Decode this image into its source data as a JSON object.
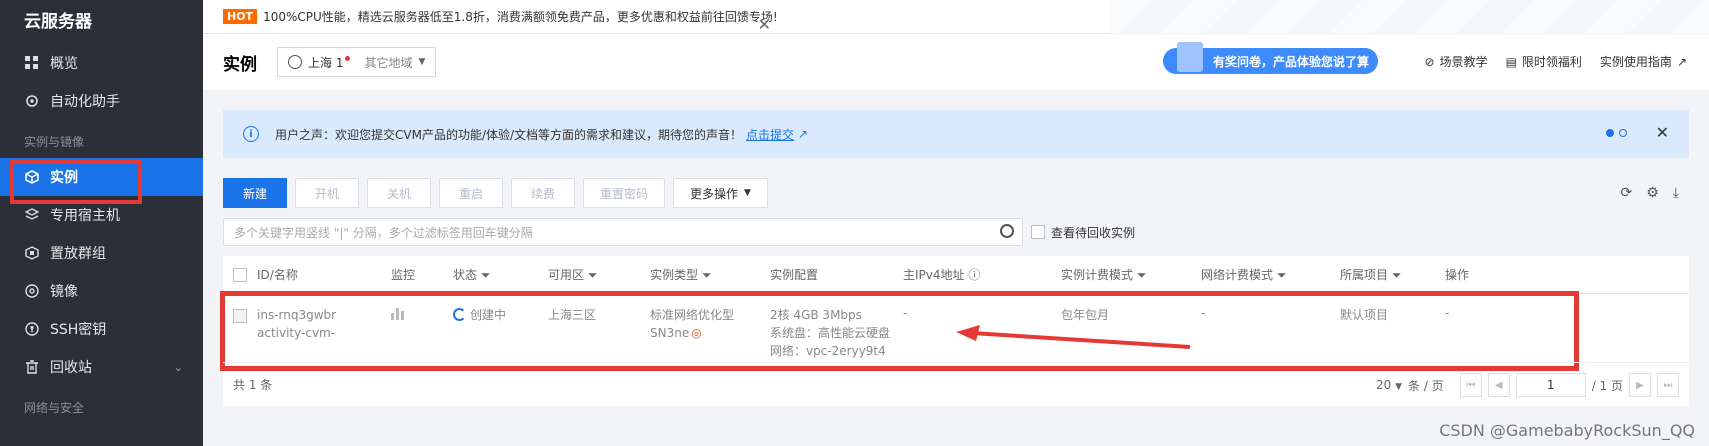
{
  "sidebar": {
    "title": "云服务器",
    "items_top": [
      {
        "label": "概览",
        "icon": "grid-icon"
      },
      {
        "label": "自动化助手",
        "icon": "gear-robot-icon"
      }
    ],
    "group1": "实例与镜像",
    "items_mid": [
      {
        "label": "实例",
        "icon": "cube-icon"
      },
      {
        "label": "专用宿主机",
        "icon": "layers-icon"
      },
      {
        "label": "置放群组",
        "icon": "group-icon"
      },
      {
        "label": "镜像",
        "icon": "disc-icon"
      },
      {
        "label": "SSH密钥",
        "icon": "key-icon"
      },
      {
        "label": "回收站",
        "icon": "trash-icon"
      }
    ],
    "group2": "网络与安全"
  },
  "notice": {
    "badge": "HOT",
    "text": "100%CPU性能，精选云服务器低至1.8折，消费满额领免费产品，更多优惠和权益前往回馈专场!"
  },
  "header": {
    "title": "实例",
    "region": "上海 1",
    "other_region": "其它地域",
    "survey": "有奖问卷，产品体验您说了算",
    "links": [
      "场景教学",
      "限时领福利",
      "实例使用指南"
    ]
  },
  "banner": {
    "text": "用户之声：欢迎您提交CVM产品的功能/体验/文档等方面的需求和建议，期待您的声音！",
    "link": "点击提交"
  },
  "toolbar": {
    "new": "新建",
    "start": "开机",
    "stop": "关机",
    "restart": "重启",
    "renew": "续费",
    "reset_password": "重置密码",
    "more": "更多操作"
  },
  "search": {
    "placeholder": "多个关键字用竖线 \"|\" 分隔，多个过滤标签用回车键分隔",
    "recycle_label": "查看待回收实例"
  },
  "table": {
    "headers": {
      "id": "ID/名称",
      "monitor": "监控",
      "status": "状态",
      "zone": "可用区",
      "type": "实例类型",
      "config": "实例配置",
      "ip": "主IPv4地址",
      "billing": "实例计费模式",
      "net_billing": "网络计费模式",
      "project": "所属项目",
      "ops": "操作"
    },
    "row": {
      "id": "ins-rnq3gwbr",
      "name": "activity-cvm-",
      "status": "创建中",
      "zone": "上海三区",
      "type_line1": "标准网络优化型",
      "type_line2": "SN3ne",
      "config_line1": "2核 4GB 3Mbps",
      "config_line2": "系统盘：高性能云硬盘",
      "config_line3": "网络：vpc-2eryy9t4",
      "ip": "-",
      "billing": "包年包月",
      "net_billing": "-",
      "project": "默认项目",
      "ops": "-"
    },
    "total": "共 1 条",
    "page_size": "20",
    "page_size_unit": "条 / 页",
    "page_current": "1",
    "page_total": "/ 1 页"
  },
  "watermark": "CSDN @GamebabyRockSun_QQ"
}
